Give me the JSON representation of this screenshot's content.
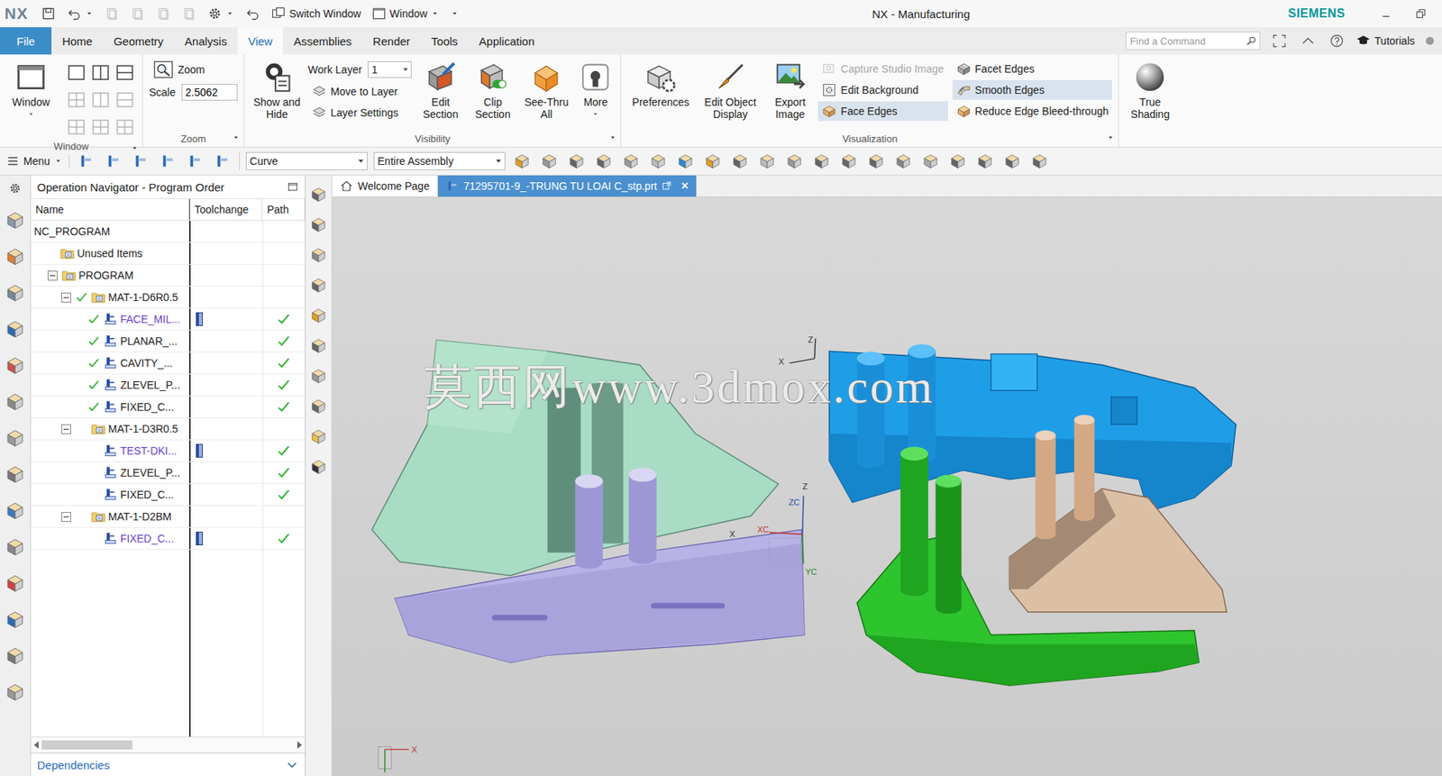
{
  "title_bar": {
    "logo": "NX",
    "switch_window": "Switch Window",
    "window_menu": "Window",
    "title": "NX - Manufacturing",
    "brand": "SIEMENS"
  },
  "ribbon_tabs": [
    {
      "label": "File",
      "selected": false,
      "kind": "file"
    },
    {
      "label": "Home",
      "selected": false,
      "kind": "tab"
    },
    {
      "label": "Geometry",
      "selected": false,
      "kind": "tab"
    },
    {
      "label": "Analysis",
      "selected": false,
      "kind": "tab"
    },
    {
      "label": "View",
      "selected": true,
      "kind": "tab"
    },
    {
      "label": "Assemblies",
      "selected": false,
      "kind": "tab"
    },
    {
      "label": "Render",
      "selected": false,
      "kind": "tab"
    },
    {
      "label": "Tools",
      "selected": false,
      "kind": "tab"
    },
    {
      "label": "Application",
      "selected": false,
      "kind": "tab"
    }
  ],
  "search": {
    "placeholder": "Find a Command"
  },
  "tutorials": "Tutorials",
  "ribbon": {
    "window": {
      "label": "Window",
      "button": "Window"
    },
    "zoom": {
      "label": "Zoom",
      "zoom": "Zoom",
      "scale_label": "Scale",
      "scale_value": "2.5062"
    },
    "visibility": {
      "label": "Visibility",
      "show_hide": "Show and Hide",
      "work_layer_label": "Work Layer",
      "work_layer_value": "1",
      "move_to_layer": "Move to Layer",
      "layer_settings": "Layer Settings",
      "buttons": [
        "Edit Section",
        "Clip Section",
        "See-Thru All",
        "More"
      ]
    },
    "visualization": {
      "label": "Visualization",
      "buttons": [
        "Preferences",
        "Edit Object Display",
        "Export Image"
      ],
      "options": [
        {
          "label": "Capture Studio Image",
          "disabled": true,
          "selected": false
        },
        {
          "label": "Edit Background",
          "disabled": false,
          "selected": false
        },
        {
          "label": "Face Edges",
          "disabled": false,
          "selected": true
        },
        {
          "label": "Facet Edges",
          "disabled": false,
          "selected": false
        },
        {
          "label": "Smooth Edges",
          "disabled": false,
          "selected": true
        },
        {
          "label": "Reduce Edge Bleed-through",
          "disabled": false,
          "selected": false
        }
      ]
    },
    "shading": {
      "button": "True Shading"
    }
  },
  "command_bar": {
    "menu": "Menu",
    "filter": "Curve",
    "scope": "Entire Assembly"
  },
  "navigator": {
    "title": "Operation Navigator - Program Order",
    "columns": [
      "Name",
      "Toolchange",
      "Path"
    ],
    "rows": [
      {
        "name": "NC_PROGRAM",
        "level": 0,
        "kind": "root",
        "expanded": false,
        "done": false,
        "toolchange": false,
        "path_ok": false
      },
      {
        "name": "Unused Items",
        "level": 1,
        "kind": "folder",
        "expanded": false,
        "done": false,
        "toolchange": false,
        "path_ok": false
      },
      {
        "name": "PROGRAM",
        "level": 1,
        "kind": "program",
        "expanded": true,
        "done": false,
        "toolchange": false,
        "path_ok": false
      },
      {
        "name": "MAT-1-D6R0.5",
        "level": 2,
        "kind": "method",
        "expanded": true,
        "done": true,
        "toolchange": false,
        "path_ok": false
      },
      {
        "name": "FACE_MIL...",
        "level": 3,
        "kind": "operation",
        "expanded": false,
        "done": true,
        "toolchange": true,
        "path_ok": true
      },
      {
        "name": "PLANAR_...",
        "level": 3,
        "kind": "operation",
        "expanded": false,
        "done": true,
        "toolchange": false,
        "path_ok": true
      },
      {
        "name": "CAVITY_...",
        "level": 3,
        "kind": "operation",
        "expanded": false,
        "done": true,
        "toolchange": false,
        "path_ok": true
      },
      {
        "name": "ZLEVEL_P...",
        "level": 3,
        "kind": "operation",
        "expanded": false,
        "done": true,
        "toolchange": false,
        "path_ok": true
      },
      {
        "name": "FIXED_C...",
        "level": 3,
        "kind": "operation",
        "expanded": false,
        "done": true,
        "toolchange": false,
        "path_ok": true
      },
      {
        "name": "MAT-1-D3R0.5",
        "level": 2,
        "kind": "method",
        "expanded": true,
        "done": false,
        "toolchange": false,
        "path_ok": false
      },
      {
        "name": "TEST-DKI...",
        "level": 3,
        "kind": "operation",
        "expanded": false,
        "done": false,
        "toolchange": true,
        "path_ok": true
      },
      {
        "name": "ZLEVEL_P...",
        "level": 3,
        "kind": "operation",
        "expanded": false,
        "done": false,
        "toolchange": false,
        "path_ok": true
      },
      {
        "name": "FIXED_C...",
        "level": 3,
        "kind": "operation",
        "expanded": false,
        "done": false,
        "toolchange": false,
        "path_ok": true
      },
      {
        "name": "MAT-1-D2BM",
        "level": 2,
        "kind": "method",
        "expanded": true,
        "done": false,
        "toolchange": false,
        "path_ok": false
      },
      {
        "name": "FIXED_C...",
        "level": 3,
        "kind": "operation",
        "expanded": false,
        "done": false,
        "toolchange": true,
        "path_ok": true
      }
    ],
    "footer": "Dependencies"
  },
  "graphics": {
    "tabs": [
      {
        "label": "Welcome Page",
        "selected": false
      },
      {
        "label": "71295701-9_-TRUNG TU LOAI C_stp.prt",
        "selected": true
      }
    ],
    "close": "×",
    "watermark": "莫西网www.3dmox.com",
    "triads": [
      [
        "Z",
        "X"
      ],
      [
        "Z",
        "ZC",
        "X",
        "XC",
        "YC"
      ],
      [
        "X"
      ]
    ]
  }
}
